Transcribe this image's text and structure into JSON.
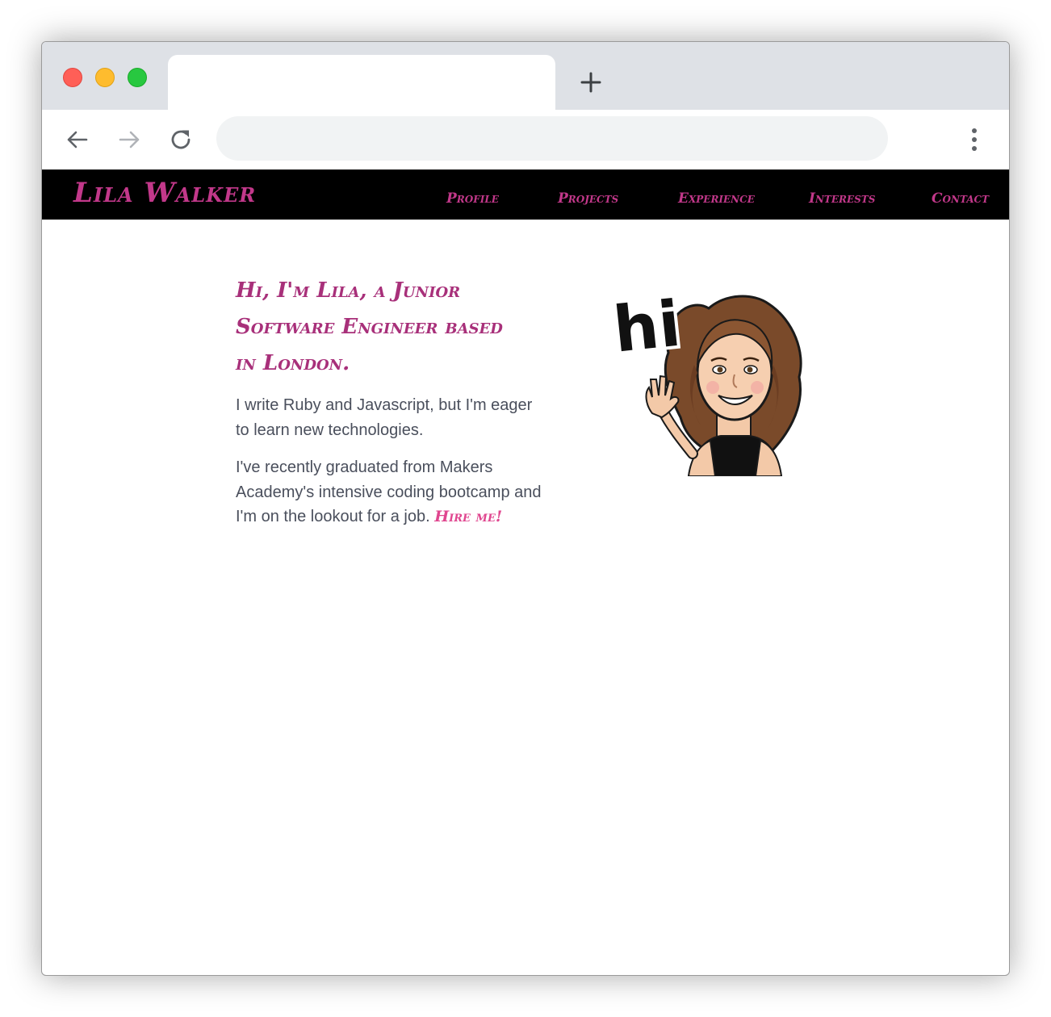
{
  "browser": {
    "tab_title": "",
    "address": "",
    "new_tab_icon": "plus-icon",
    "back_icon": "arrow-left-icon",
    "forward_icon": "arrow-right-icon",
    "reload_icon": "reload-icon",
    "menu_icon": "kebab-menu-icon"
  },
  "site": {
    "brand": "Lila Walker",
    "nav": [
      {
        "label": "Profile"
      },
      {
        "label": "Projects"
      },
      {
        "label": "Experience"
      },
      {
        "label": "Interests"
      },
      {
        "label": "Contact"
      }
    ]
  },
  "intro": {
    "headline_lines": [
      "Hi, I'm Lila, a Junior",
      "Software Engineer based",
      "in London."
    ],
    "para1": "I write Ruby and Javascript, but I'm eager to learn new technologies.",
    "para2": "I've recently graduated from Makers Academy's intensive coding bootcamp and I'm on the lookout for a job.",
    "hire_link": "Hire me!",
    "avatar_text": "hi"
  },
  "colors": {
    "accent": "#c2388a",
    "headline": "#a8307a",
    "link": "#e0468f",
    "nav_bg": "#000000",
    "body_text": "#4a4f5c",
    "tabstrip": "#dee1e6",
    "omnibox": "#f1f3f4"
  }
}
